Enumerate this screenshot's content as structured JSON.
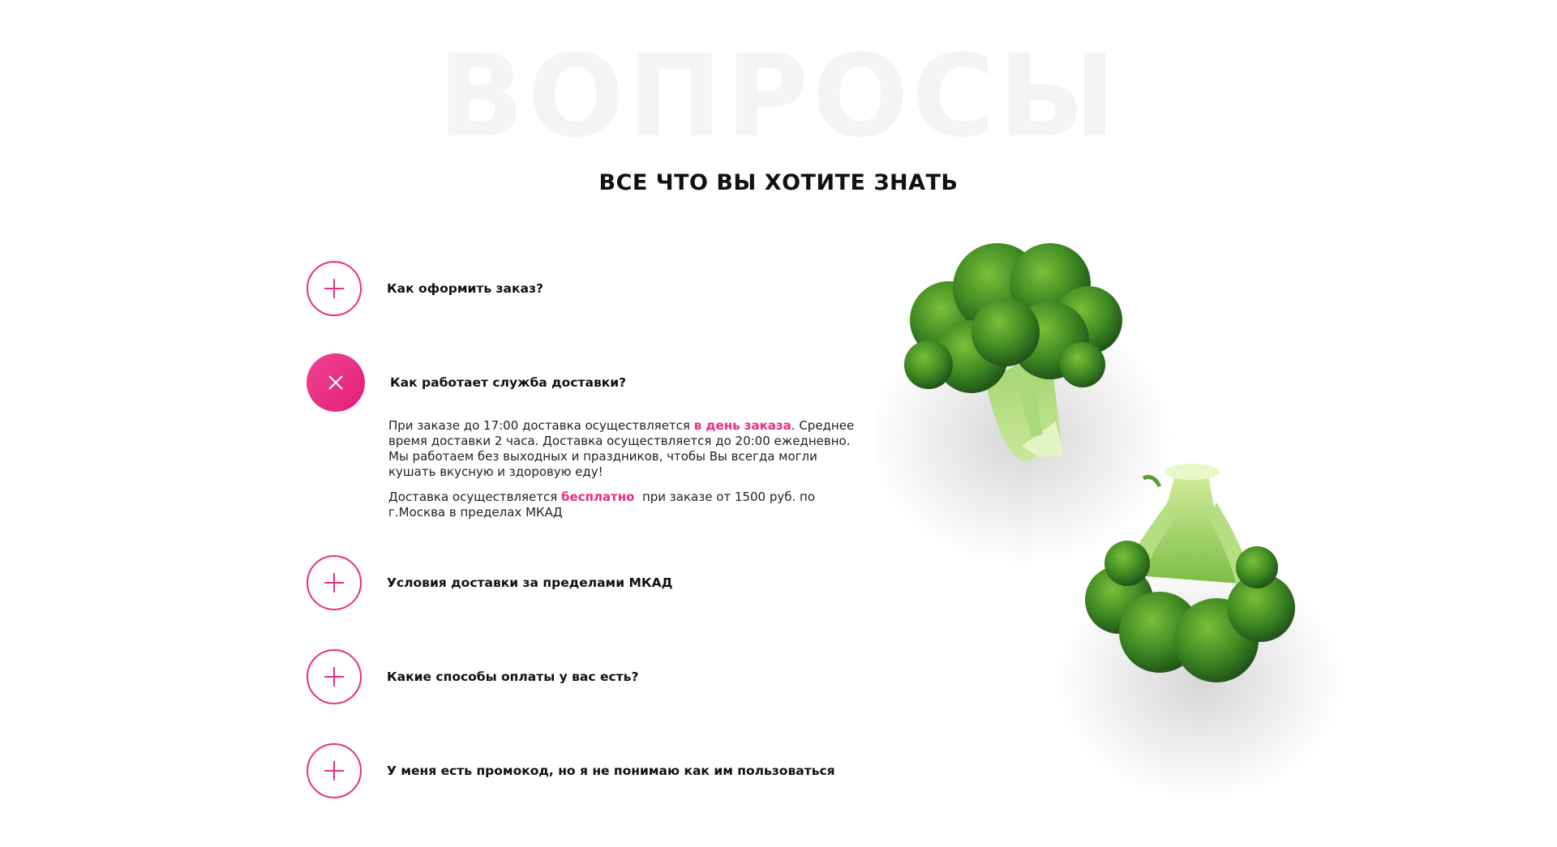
{
  "section": {
    "background_title": "ВОПРОСЫ",
    "subtitle": "ВСЕ ЧТО ВЫ ХОТИТЕ ЗНАТЬ"
  },
  "colors": {
    "accent": "#ea2d83",
    "background_title": "#f4f4f4"
  },
  "faq": {
    "items": [
      {
        "question": "Как оформить заказ?",
        "state": "collapsed",
        "icon": "plus-icon"
      },
      {
        "question": "Как работает служба доставки?",
        "state": "expanded",
        "icon": "close-icon",
        "answer": {
          "p1_before": "При заказе до 17:00 доставка осуществляется ",
          "p1_highlight": "в день заказа",
          "p1_after": ". Среднее время доставки 2 часа. Доставка осуществляется до 20:00 ежедневно. Мы работаем без выходных и праздников, чтобы Вы всегда могли кушать вкусную и здоровую еду!",
          "p2_before": "Доставка осуществляется ",
          "p2_highlight": "бесплатно",
          "p2_after": "  при заказе от 1500 руб. по г.Москва в пределах МКАД"
        }
      },
      {
        "question": "Условия доставки за пределами МКАД",
        "state": "collapsed",
        "icon": "plus-icon"
      },
      {
        "question": "Какие способы оплаты у вас есть?",
        "state": "collapsed",
        "icon": "plus-icon"
      },
      {
        "question": "У меня есть промокод, но я не понимаю как им пользоваться",
        "state": "collapsed",
        "icon": "plus-icon"
      }
    ]
  },
  "illustration": {
    "subject": "broccoli"
  }
}
